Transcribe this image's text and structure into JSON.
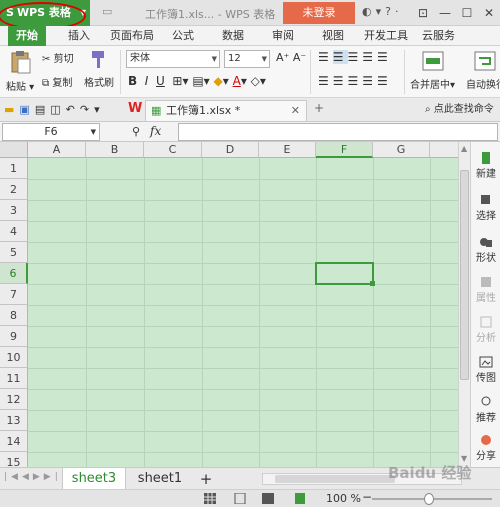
{
  "titlebar": {
    "app_name": "WPS 表格",
    "doc_title": "工作簿1.xls... - WPS 表格",
    "login_button": "未登录",
    "help": "?"
  },
  "ribbon_tabs": [
    "开始",
    "插入",
    "页面布局",
    "公式",
    "数据",
    "审阅",
    "视图",
    "开发工具",
    "云服务"
  ],
  "ribbon": {
    "paste": "粘贴",
    "cut": "剪切",
    "copy": "复制",
    "format_painter": "格式刷",
    "font_name": "宋体",
    "font_size": "12",
    "merge_center": "合并居中",
    "auto_wrap": "自动换行"
  },
  "quickbar": {
    "doc_tab": "工作簿1.xlsx *",
    "search": "点此查找命令"
  },
  "formula_bar": {
    "name_box": "F6",
    "fx": "fx",
    "value": ""
  },
  "grid": {
    "columns": [
      "A",
      "B",
      "C",
      "D",
      "E",
      "F",
      "G"
    ],
    "rows": [
      "1",
      "2",
      "3",
      "4",
      "5",
      "6",
      "7",
      "8",
      "9",
      "10",
      "11",
      "12",
      "13",
      "14",
      "15"
    ],
    "selected_cell": "F6"
  },
  "task_pane": [
    {
      "label": "新建",
      "icon": "new-icon",
      "dim": false
    },
    {
      "label": "选择",
      "icon": "select-icon",
      "dim": false
    },
    {
      "label": "形状",
      "icon": "shape-icon",
      "dim": false
    },
    {
      "label": "属性",
      "icon": "properties-icon",
      "dim": true
    },
    {
      "label": "分析",
      "icon": "analyze-icon",
      "dim": true
    },
    {
      "label": "传图",
      "icon": "upload-image-icon",
      "dim": false
    },
    {
      "label": "推荐",
      "icon": "recommend-icon",
      "dim": false
    },
    {
      "label": "分享",
      "icon": "share-icon",
      "dim": false
    }
  ],
  "sheets": {
    "tabs": [
      "sheet3",
      "sheet1"
    ],
    "active": "sheet3",
    "add": "+"
  },
  "status": {
    "zoom": "100 %",
    "zoom_out": "−",
    "zoom_level": 1.0
  },
  "watermark": "Baidu 经验"
}
